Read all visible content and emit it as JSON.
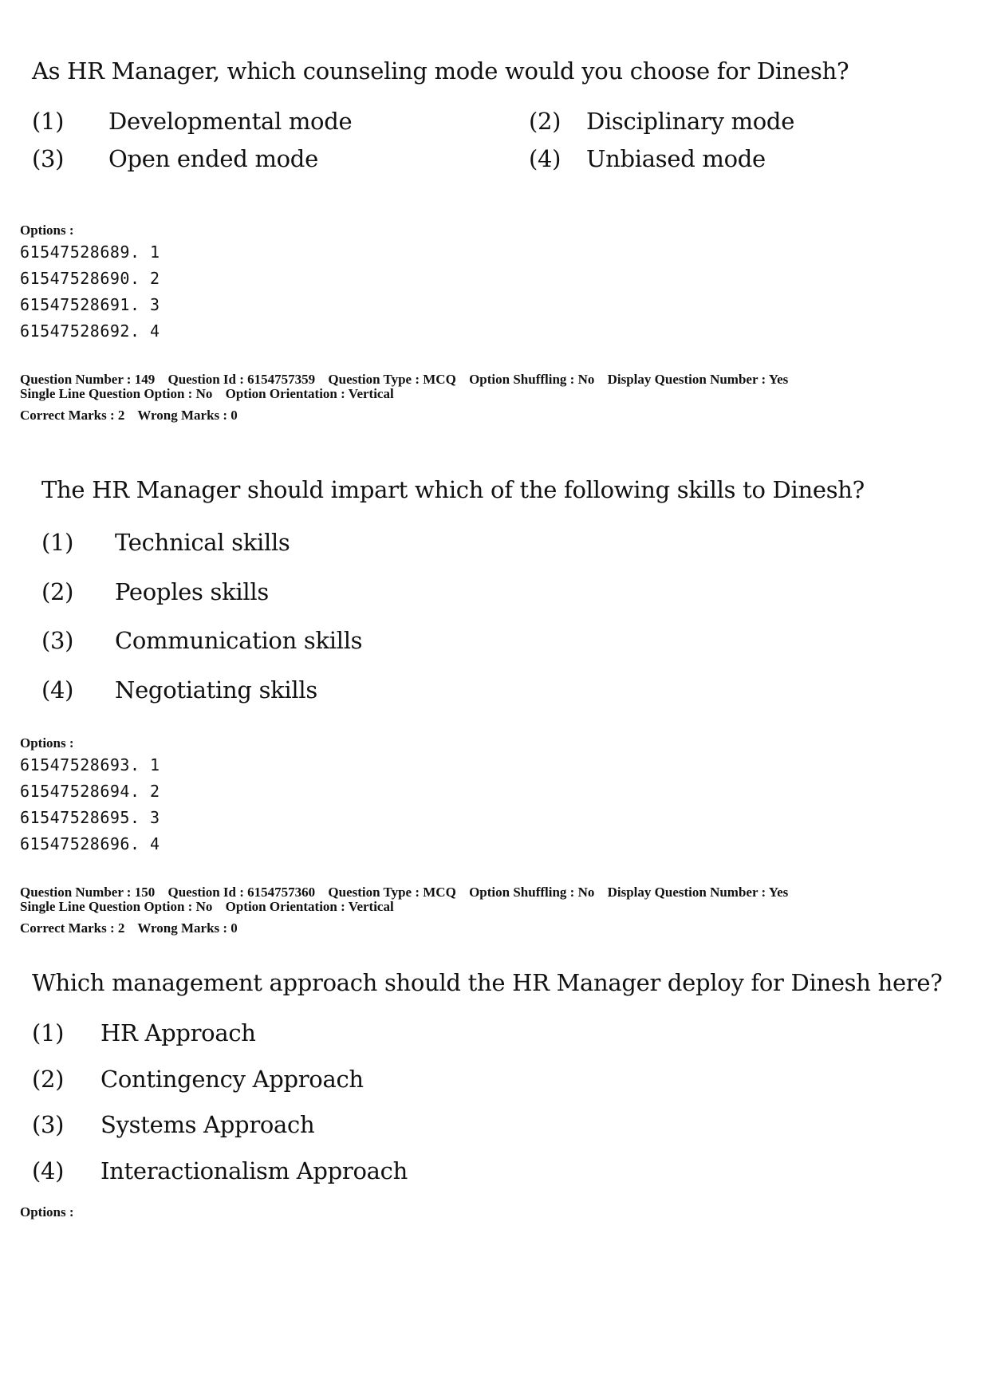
{
  "q148": {
    "question": "As HR Manager, which counseling mode would you choose for Dinesh?",
    "choices": [
      {
        "num": "(1)",
        "text": "Developmental mode"
      },
      {
        "num": "(2)",
        "text": "Disciplinary mode"
      },
      {
        "num": "(3)",
        "text": "Open ended mode"
      },
      {
        "num": "(4)",
        "text": "Unbiased mode"
      }
    ],
    "options_label": "Options :",
    "option_ids": [
      "61547528689. 1",
      "61547528690. 2",
      "61547528691. 3",
      "61547528692. 4"
    ]
  },
  "q149": {
    "meta_line1": [
      "Question Number : 149",
      "Question Id : 6154757359",
      "Question Type : MCQ",
      "Option Shuffling : No",
      "Display Question Number : Yes"
    ],
    "meta_line2": [
      "Single Line Question Option : No",
      "Option Orientation : Vertical"
    ],
    "marks": [
      "Correct Marks : 2",
      "Wrong Marks : 0"
    ],
    "question": "The HR Manager should impart which of the following skills to Dinesh?",
    "choices": [
      {
        "num": "(1)",
        "text": "Technical skills"
      },
      {
        "num": "(2)",
        "text": "Peoples skills"
      },
      {
        "num": "(3)",
        "text": "Communication skills"
      },
      {
        "num": "(4)",
        "text": "Negotiating skills"
      }
    ],
    "options_label": "Options :",
    "option_ids": [
      "61547528693. 1",
      "61547528694. 2",
      "61547528695. 3",
      "61547528696. 4"
    ]
  },
  "q150": {
    "meta_line1": [
      "Question Number : 150",
      "Question Id : 6154757360",
      "Question Type : MCQ",
      "Option Shuffling : No",
      "Display Question Number : Yes"
    ],
    "meta_line2": [
      "Single Line Question Option : No",
      "Option Orientation : Vertical"
    ],
    "marks": [
      "Correct Marks : 2",
      "Wrong Marks : 0"
    ],
    "question": "Which management approach should the HR Manager deploy for Dinesh here?",
    "choices": [
      {
        "num": "(1)",
        "text": "HR Approach"
      },
      {
        "num": "(2)",
        "text": "Contingency Approach"
      },
      {
        "num": "(3)",
        "text": "Systems Approach"
      },
      {
        "num": "(4)",
        "text": "Interactionalism Approach"
      }
    ],
    "options_label": "Options :"
  }
}
